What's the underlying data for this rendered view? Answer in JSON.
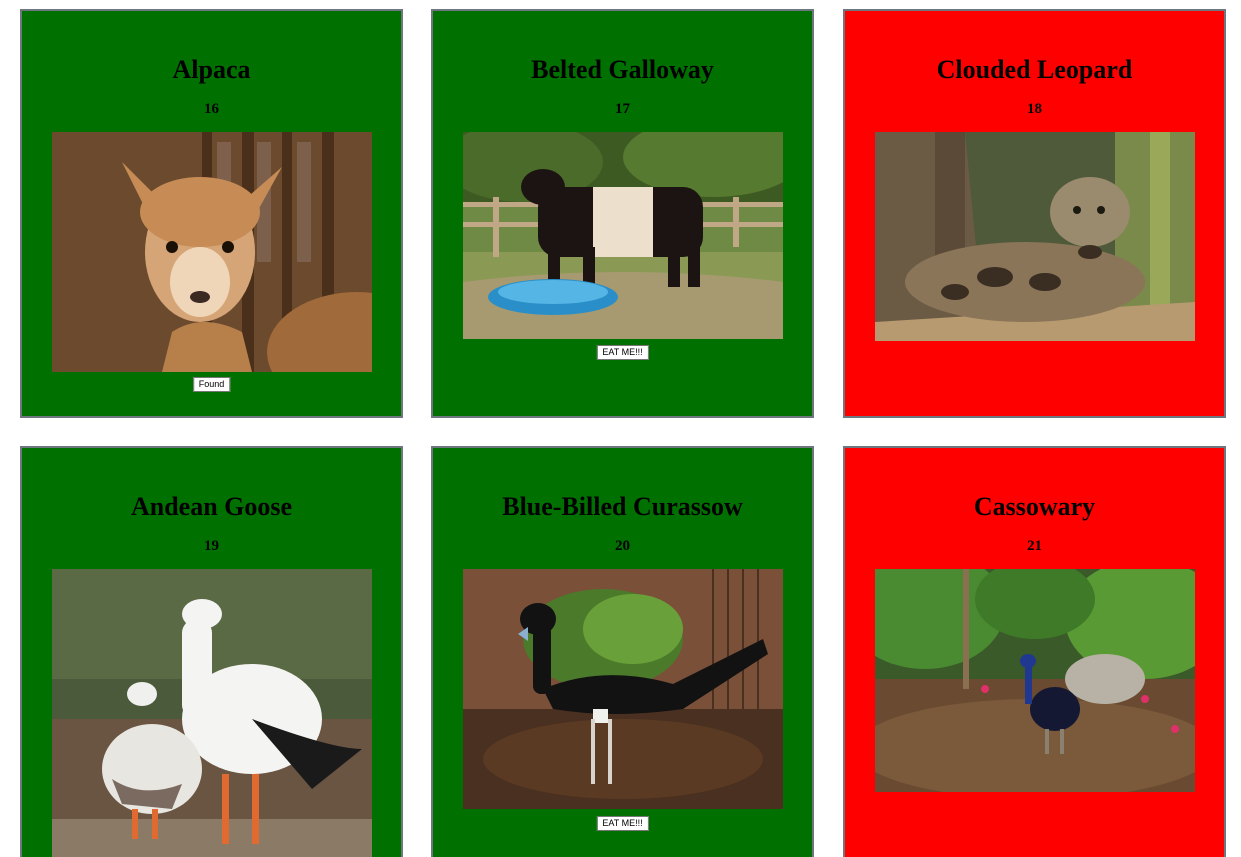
{
  "cards": [
    {
      "name": "Alpaca",
      "number": "16",
      "status": "green",
      "button": "Found"
    },
    {
      "name": "Belted Galloway",
      "number": "17",
      "status": "green",
      "button": "EAT ME!!!"
    },
    {
      "name": "Clouded Leopard",
      "number": "18",
      "status": "red",
      "button": ""
    },
    {
      "name": "Andean Goose",
      "number": "19",
      "status": "green",
      "button": ""
    },
    {
      "name": "Blue-Billed Curassow",
      "number": "20",
      "status": "green",
      "button": "EAT ME!!!"
    },
    {
      "name": "Cassowary",
      "number": "21",
      "status": "red",
      "button": ""
    }
  ],
  "colors": {
    "green": "#007000",
    "red": "#ff0000",
    "border": "#6e7780"
  }
}
